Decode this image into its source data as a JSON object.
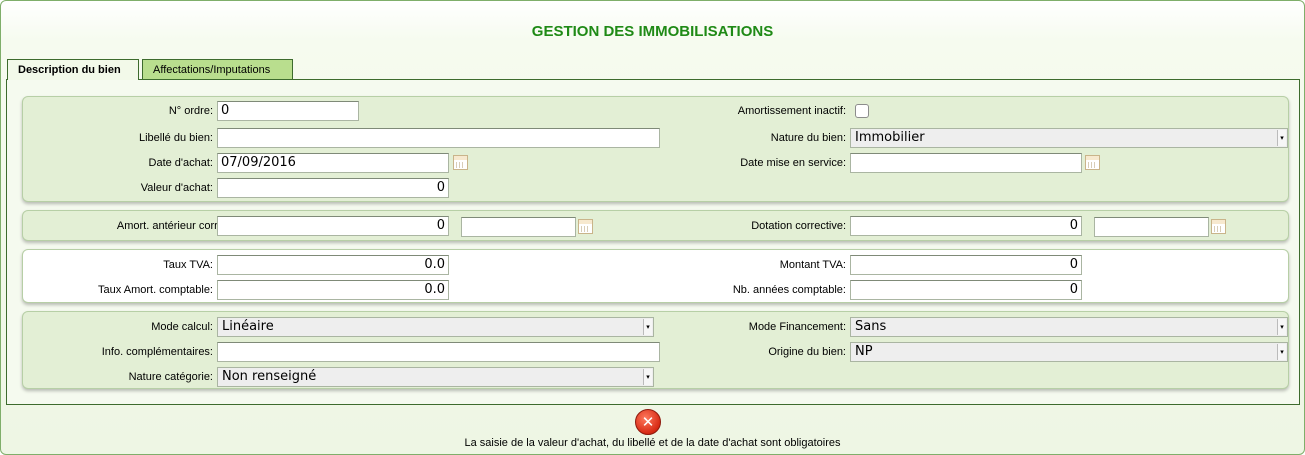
{
  "header": {
    "title": "GESTION DES IMMOBILISATIONS"
  },
  "tabs": [
    {
      "label": "Description du bien",
      "active": true
    },
    {
      "label": "Affectations/Imputations",
      "active": false
    }
  ],
  "group1": {
    "no_ordre": {
      "label": "N° ordre:",
      "value": "0"
    },
    "libelle": {
      "label": "Libellé du bien:",
      "value": ""
    },
    "date_achat": {
      "label": "Date d'achat:",
      "value": "07/09/2016"
    },
    "valeur_achat": {
      "label": "Valeur d'achat:",
      "value": "0"
    },
    "amort_inactif": {
      "label": "Amortissement inactif:",
      "checked": false
    },
    "nature_bien": {
      "label": "Nature du bien:",
      "value": "Immobilier"
    },
    "date_service": {
      "label": "Date mise en service:",
      "value": ""
    }
  },
  "group2": {
    "amort_anterieur": {
      "label": "Amort. antérieur correctif:",
      "value": "0",
      "date": ""
    },
    "dotation": {
      "label": "Dotation corrective:",
      "value": "0",
      "date": ""
    }
  },
  "group3": {
    "taux_tva": {
      "label": "Taux TVA:",
      "value": "0.0"
    },
    "taux_amort": {
      "label": "Taux Amort. comptable:",
      "value": "0.0"
    },
    "montant_tva": {
      "label": "Montant TVA:",
      "value": "0"
    },
    "nb_annees": {
      "label": "Nb. années comptable:",
      "value": "0"
    }
  },
  "group4": {
    "mode_calcul": {
      "label": "Mode calcul:",
      "value": "Linéaire"
    },
    "info_comp": {
      "label": "Info. complémentaires:",
      "value": ""
    },
    "nature_cat": {
      "label": "Nature catégorie:",
      "value": "Non renseigné"
    },
    "mode_fin": {
      "label": "Mode Financement:",
      "value": "Sans"
    },
    "origine": {
      "label": "Origine du bien:",
      "value": "NP"
    }
  },
  "footer": {
    "error_icon": "close-icon",
    "error_message": "La saisie de la valeur d'achat, du libellé et de la date d'achat sont obligatoires"
  },
  "colors": {
    "title": "#1f8a16",
    "tab_inactive": "#b9de8e",
    "group_bg": "#e3efd5",
    "error": "#d72a14"
  }
}
